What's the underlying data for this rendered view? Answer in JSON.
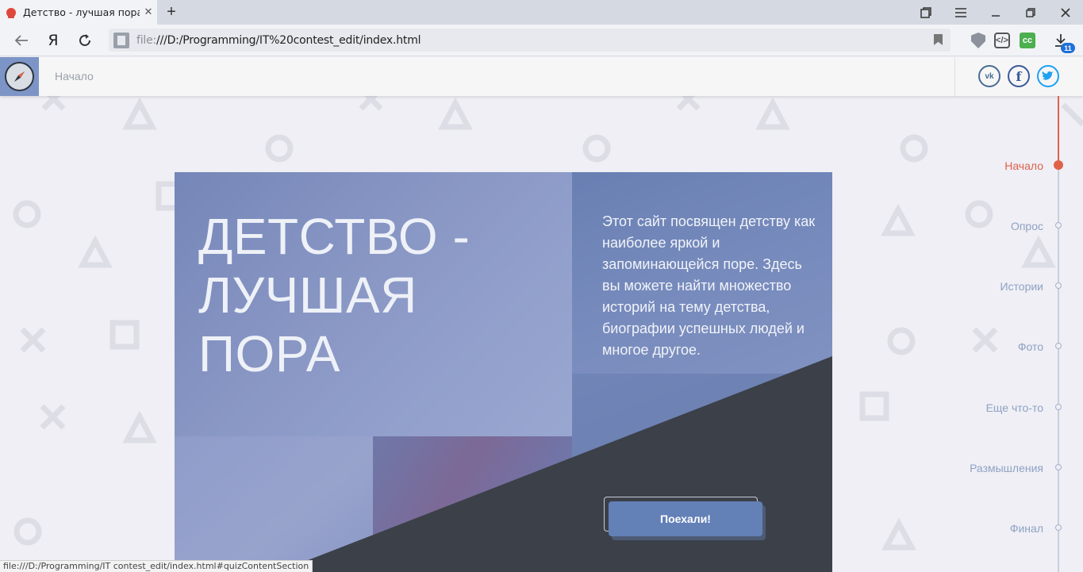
{
  "browser": {
    "tab_title": "Детство - лучшая пора",
    "tab_close": "✕",
    "new_tab": "+",
    "yandex_label": "Я",
    "url_scheme": "file:",
    "url_rest": "///D:/Programming/IT%20contest_edit/index.html",
    "downloads_count": "11",
    "status_url": "file:///D:/Programming/IT contest_edit/index.html#quizContentSection"
  },
  "header": {
    "nav_item": "Начало"
  },
  "hero": {
    "title": "ДЕТСТВО - ЛУЧШАЯ ПОРА",
    "description": "Этот сайт посвящен детству как наиболее яркой и запоминающейся поре. Здесь вы можете найти множество историй на тему детства, биографии успешных людей и многое другое.",
    "cta_label": "Поехали!"
  },
  "sections": [
    {
      "label": "Начало",
      "active": true
    },
    {
      "label": "Опрос",
      "active": false
    },
    {
      "label": "Истории",
      "active": false
    },
    {
      "label": "Фото",
      "active": false
    },
    {
      "label": "Еще что-то",
      "active": false
    },
    {
      "label": "Размышления",
      "active": false
    },
    {
      "label": "Финал",
      "active": false
    }
  ],
  "colors": {
    "accent": "#e0614a",
    "brand": "#7d95c6",
    "button": "#6380b7"
  },
  "icons": {
    "logo": "compass-icon",
    "vk": "vk-icon",
    "facebook": "facebook-icon",
    "twitter": "twitter-icon"
  }
}
